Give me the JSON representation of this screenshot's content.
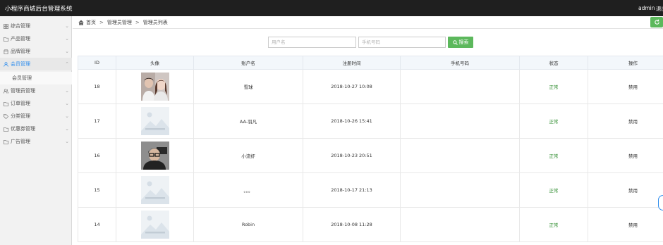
{
  "header": {
    "app_title": "小程序商城后台管理系统",
    "user": "admin",
    "logout": "退出"
  },
  "sidebar": {
    "items": [
      {
        "label": "综合管理",
        "icon": "grid-icon"
      },
      {
        "label": "产品管理",
        "icon": "folder-icon"
      },
      {
        "label": "品牌管理",
        "icon": "store-icon"
      },
      {
        "label": "会员管理",
        "icon": "user-icon",
        "active": true
      },
      {
        "label": "管理员管理",
        "icon": "users-icon"
      },
      {
        "label": "订单管理",
        "icon": "folder-icon"
      },
      {
        "label": "分类管理",
        "icon": "tag-icon"
      },
      {
        "label": "优惠券管理",
        "icon": "folder-icon"
      },
      {
        "label": "广告管理",
        "icon": "folder-icon"
      }
    ],
    "sub_items": [
      {
        "label": "会员管理"
      }
    ]
  },
  "breadcrumb": {
    "items": [
      "首页",
      "管理员管理",
      "管理员列表"
    ],
    "separator": ">"
  },
  "search": {
    "username_placeholder": "用户名",
    "phone_placeholder": "手机号码",
    "button_label": "搜索"
  },
  "table": {
    "headers": [
      "ID",
      "头像",
      "账户名",
      "注册时间",
      "手机号码",
      "状态",
      "操作"
    ],
    "rows": [
      {
        "id": "18",
        "avatar": "photo-couple",
        "name": "雪球",
        "time": "2018-10-27 10:08",
        "phone": "",
        "status": "正常",
        "action": "禁用"
      },
      {
        "id": "17",
        "avatar": "placeholder",
        "name": "AA-羽凡",
        "time": "2018-10-26 15:41",
        "phone": "",
        "status": "正常",
        "action": "禁用"
      },
      {
        "id": "16",
        "avatar": "photo-man",
        "name": "小流虾",
        "time": "2018-10-23 20:51",
        "phone": "",
        "status": "正常",
        "action": "禁用"
      },
      {
        "id": "15",
        "avatar": "placeholder",
        "name": "。。。",
        "time": "2018-10-17 21:13",
        "phone": "",
        "status": "正常",
        "action": "禁用"
      },
      {
        "id": "14",
        "avatar": "placeholder",
        "name": "Robin",
        "time": "2018-10-08 11:28",
        "phone": "",
        "status": "正常",
        "action": "禁用"
      }
    ]
  },
  "colors": {
    "topbar": "#1f1f1f",
    "accent_green": "#5cb85c",
    "status_green": "#2a8a2a",
    "active_blue": "#2e8ded"
  }
}
